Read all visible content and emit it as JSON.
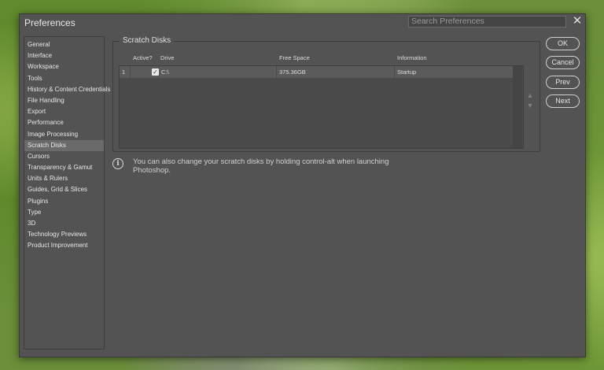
{
  "window": {
    "title": "Preferences",
    "search_placeholder": "Search Preferences",
    "close_glyph": "✕"
  },
  "sidebar": {
    "items": [
      {
        "label": "General"
      },
      {
        "label": "Interface"
      },
      {
        "label": "Workspace"
      },
      {
        "label": "Tools"
      },
      {
        "label": "History & Content Credentials"
      },
      {
        "label": "File Handling"
      },
      {
        "label": "Export"
      },
      {
        "label": "Performance"
      },
      {
        "label": "Image Processing"
      },
      {
        "label": "Scratch Disks",
        "active": true
      },
      {
        "label": "Cursors"
      },
      {
        "label": "Transparency & Gamut"
      },
      {
        "label": "Units & Rulers"
      },
      {
        "label": "Guides, Grid & Slices"
      },
      {
        "label": "Plugins"
      },
      {
        "label": "Type"
      },
      {
        "label": "3D"
      },
      {
        "label": "Technology Previews"
      },
      {
        "label": "Product Improvement"
      }
    ]
  },
  "scratch_disks": {
    "group_title": "Scratch Disks",
    "columns": {
      "active": "Active?",
      "drive": "Drive",
      "free_space": "Free Space",
      "information": "Information"
    },
    "rows": [
      {
        "index": "1",
        "active": true,
        "drive": "C:\\",
        "free_space": "375.36GB",
        "information": "Startup"
      }
    ],
    "move_up_glyph": "▲",
    "move_down_glyph": "▼"
  },
  "info": {
    "icon_glyph": "i",
    "text": "You can also change your scratch disks by holding control-alt when launching Photoshop."
  },
  "buttons": {
    "ok": "OK",
    "cancel": "Cancel",
    "prev": "Prev",
    "next": "Next"
  },
  "colors": {
    "panel": "#535353",
    "selection": "#6a6a6a"
  }
}
